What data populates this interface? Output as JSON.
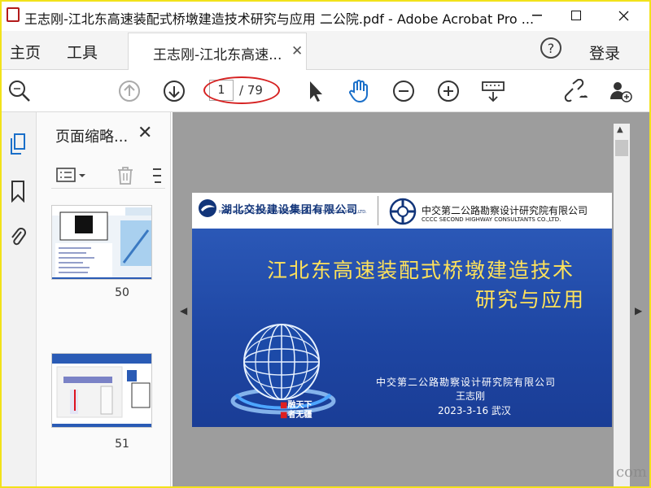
{
  "window": {
    "title": "王志刚-江北东高速装配式桥墩建造技术研究与应用 二公院.pdf - Adobe Acrobat Pro ..."
  },
  "menu": {
    "home": "主页",
    "tools": "工具",
    "doc_tab": "王志刚-江北东高速...",
    "help": "?",
    "login": "登录"
  },
  "toolbar": {
    "page_current": "1",
    "page_total": "/ 79"
  },
  "thumbnails": {
    "title": "页面缩略...",
    "items": [
      {
        "page": "50"
      },
      {
        "page": "51"
      }
    ]
  },
  "document": {
    "company_left": "湖北交投建设集团有限公司",
    "company_left_en": "HUBEI COMMUNICATIONS INVESTMENT CONSTRUCTION GROUP CO.,LTD.",
    "company_right": "中交第二公路勘察设计研究院有限公司",
    "company_right_en": "CCCC SECOND HIGHWAY CONSULTANTS CO.,LTD.",
    "title_line1": "江北东高速装配式桥墩建造技术",
    "title_line2": "研究与应用",
    "org": "中交第二公路勘察设计研究院有限公司",
    "author": "王志刚",
    "date": "2023-3-16 武汉",
    "slogan_line1": "融天下",
    "slogan_line2": "者无疆"
  },
  "watermark": "com",
  "colors": {
    "accent_red": "#d62222",
    "slide_blue": "#2b58b7",
    "title_yellow": "#ffe25a",
    "frame_yellow": "#f2e21a"
  }
}
